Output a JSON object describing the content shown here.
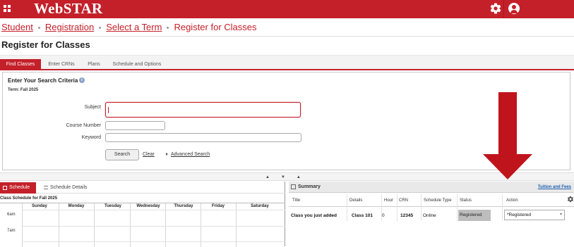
{
  "app": {
    "title": "WebSTAR"
  },
  "breadcrumb": [
    "Student",
    "Registration",
    "Select a Term",
    "Register for Classes"
  ],
  "page": {
    "title": "Register for Classes"
  },
  "tabs": [
    "Find Classes",
    "Enter CRNs",
    "Plans",
    "Schedule and Options"
  ],
  "search": {
    "heading": "Enter Your Search Criteria",
    "info": "i",
    "term": "Term: Fall 2025",
    "subject_label": "Subject",
    "subject_value": "",
    "course_number_label": "Course Number",
    "course_number_value": "",
    "keyword_label": "Keyword",
    "keyword_value": "",
    "search_button": "Search",
    "clear_link": "Clear",
    "advanced_link": "Advanced Search"
  },
  "splitter": {
    "glyphs": "▲▼▲"
  },
  "schedule": {
    "tab_schedule": "Schedule",
    "tab_details": "Schedule Details",
    "title": "Class Schedule for Fall 2025",
    "days": [
      "Sunday",
      "Monday",
      "Tuesday",
      "Wednesday",
      "Thursday",
      "Friday",
      "Saturday"
    ],
    "hours": [
      "6am",
      "7am"
    ]
  },
  "summary": {
    "title": "Summary",
    "tuition_link": "Tuition and Fees",
    "columns": [
      "Title",
      "Details",
      "Hour",
      "CRN",
      "Schedule Type",
      "Status",
      "Action"
    ],
    "row": {
      "title": "Class you just added",
      "details": "Class 101",
      "hour": "0",
      "crn": "12345",
      "schedule_type": "Online",
      "status": "Registered",
      "action": "*Registered"
    }
  },
  "colors": {
    "brand_red": "#c4202a",
    "arrow_red": "#c0141c",
    "link_blue": "#1b5fae"
  },
  "icons": [
    "apps-grid-icon",
    "gear-icon",
    "user-icon",
    "info-icon",
    "calendar-icon",
    "list-icon",
    "summary-icon",
    "settings-gear-icon",
    "down-arrow-icon"
  ]
}
